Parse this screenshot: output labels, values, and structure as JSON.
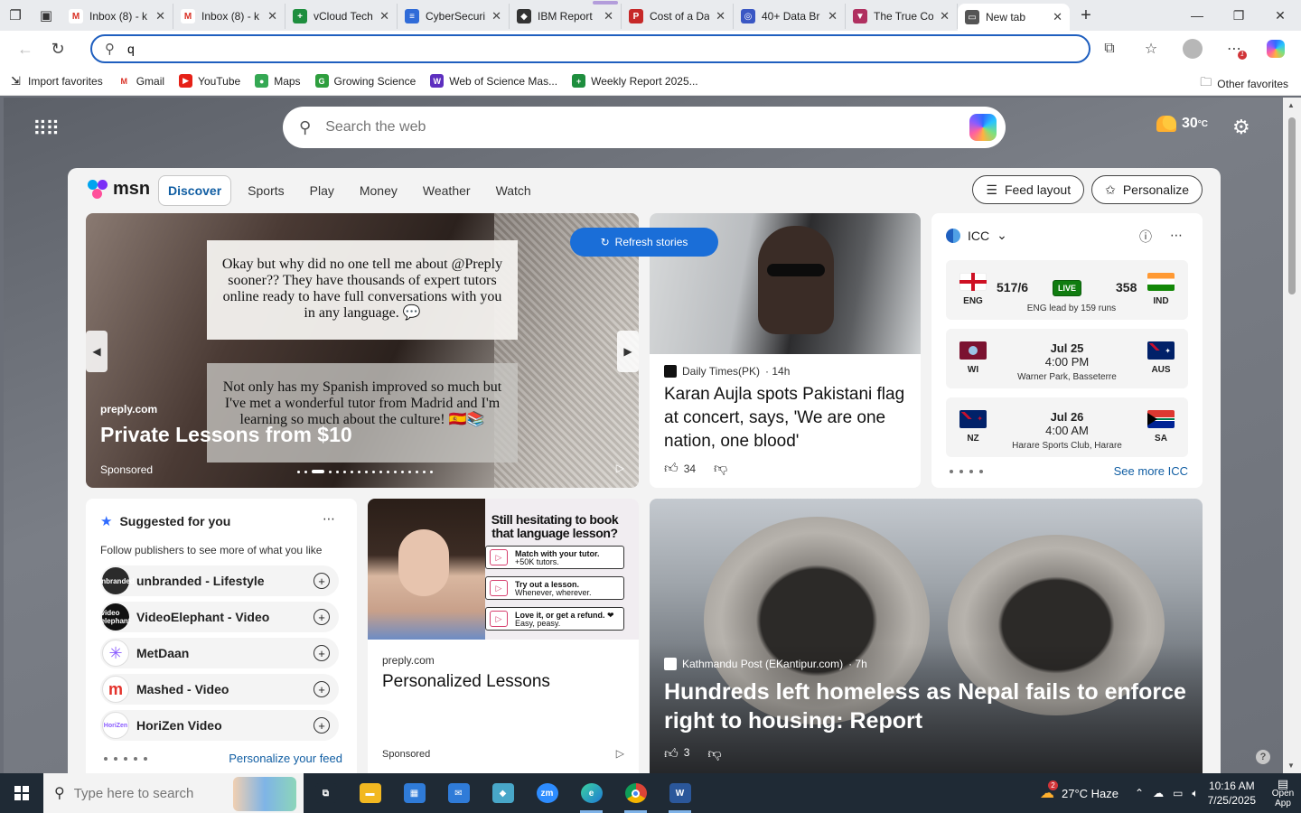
{
  "browser": {
    "tabs": [
      {
        "title": "Inbox (8) - k",
        "icon": "gmail-icon",
        "color": "#ffffff",
        "glyph": "M"
      },
      {
        "title": "Inbox (8) - k",
        "icon": "gmail-icon",
        "color": "#ffffff",
        "glyph": "M"
      },
      {
        "title": "vCloud Tech",
        "icon": "sheets-icon",
        "color": "#1e8e3e",
        "glyph": "+"
      },
      {
        "title": "CyberSecuri",
        "icon": "docs-icon",
        "color": "#2f6bd8",
        "glyph": "≡"
      },
      {
        "title": "IBM Report",
        "icon": "ibm-icon",
        "color": "#333333",
        "glyph": "◆"
      },
      {
        "title": "Cost of a Da",
        "icon": "pdf-icon",
        "color": "#c62828",
        "glyph": "P"
      },
      {
        "title": "40+ Data Br",
        "icon": "shield-icon",
        "color": "#3a57c4",
        "glyph": "◎"
      },
      {
        "title": "The True Co",
        "icon": "shield-icon",
        "color": "#b03060",
        "glyph": "▼"
      },
      {
        "title": "New tab",
        "icon": "newtab-icon",
        "color": "#555555",
        "glyph": "▭"
      }
    ],
    "address": {
      "value": "q"
    },
    "favorites": [
      {
        "label": "Import favorites",
        "icon": "import-icon",
        "color": "#555555",
        "glyph": "⇲"
      },
      {
        "label": "Gmail",
        "icon": "gmail-icon",
        "color": "#ffffff",
        "glyph": "M"
      },
      {
        "label": "YouTube",
        "icon": "youtube-icon",
        "color": "#e62117",
        "glyph": "▶"
      },
      {
        "label": "Maps",
        "icon": "maps-icon",
        "color": "#34a853",
        "glyph": "●"
      },
      {
        "label": "Growing Science",
        "icon": "growing-science-icon",
        "color": "#2e9e3e",
        "glyph": "G"
      },
      {
        "label": "Web of Science Mas...",
        "icon": "web-of-science-icon",
        "color": "#5d2fbf",
        "glyph": "W"
      },
      {
        "label": "Weekly Report 2025...",
        "icon": "sheets-icon",
        "color": "#1e8e3e",
        "glyph": "+"
      }
    ],
    "other_favorites": "Other favorites"
  },
  "newtab": {
    "search_placeholder": "Search the web",
    "temperature": "30",
    "temperature_unit": "°C"
  },
  "msn": {
    "logo_text": "msn",
    "nav": [
      "Discover",
      "Sports",
      "Play",
      "Money",
      "Weather",
      "Watch"
    ],
    "feed_layout": "Feed layout",
    "personalize": "Personalize",
    "refresh": "Refresh stories",
    "hero": {
      "quote1": "Okay but why did no one tell me about @Preply sooner?? They have thousands of expert tutors online ready to have full conversations with you in any language. 💬",
      "quote2": "Not only has my Spanish improved so much but I've met a wonderful tutor from Madrid and I'm learning so much about the culture! 🇪🇸📚",
      "source": "preply.com",
      "title": "Private Lessons from $10",
      "sponsored": "Sponsored"
    },
    "news": {
      "source": "Daily Times(PK)",
      "age": "· 14h",
      "title": "Karan Aujla spots Pakistani flag at concert, says, 'We are one nation, one blood'",
      "likes": "34"
    },
    "icc": {
      "title": "ICC",
      "live": {
        "team1": "ENG",
        "score1": "517/6",
        "team2": "IND",
        "score2": "358",
        "status": "LIVE",
        "note": "ENG lead by 159 runs"
      },
      "upcoming": [
        {
          "team1": "WI",
          "team2": "AUS",
          "date": "Jul 25",
          "time": "4:00 PM",
          "venue": "Warner Park, Basseterre"
        },
        {
          "team1": "NZ",
          "team2": "SA",
          "date": "Jul 26",
          "time": "4:00 AM",
          "venue": "Harare Sports Club, Harare"
        }
      ],
      "see_more": "See more ICC"
    },
    "suggested": {
      "title": "Suggested for you",
      "subtitle": "Follow publishers to see more of what you like",
      "publishers": [
        {
          "name": "unbranded - Lifestyle",
          "logo": "unbranded",
          "color": "#2b2b2b"
        },
        {
          "name": "VideoElephant - Video",
          "logo": "video elephant",
          "color": "#111111"
        },
        {
          "name": "MetDaan",
          "logo": "✳",
          "color": "#ffffff"
        },
        {
          "name": "Mashed - Video",
          "logo": "m",
          "color": "#ffffff"
        },
        {
          "name": "HoriZen Video",
          "logo": "HoriZen",
          "color": "#ffffff"
        }
      ],
      "link": "Personalize your feed"
    },
    "ad": {
      "headline": "Still hesitating to book that language lesson?",
      "features": [
        {
          "title": "Match with your tutor.",
          "sub": "+50K tutors."
        },
        {
          "title": "Try out a lesson.",
          "sub": "Whenever, wherever."
        },
        {
          "title": "Love it, or get a refund. ❤",
          "sub": "Easy, peasy."
        }
      ],
      "source": "preply.com",
      "title": "Personalized Lessons",
      "sponsored": "Sponsored"
    },
    "bignews": {
      "source": "Kathmandu Post (EKantipur.com)",
      "age": "· 7h",
      "title": "Hundreds left homeless as Nepal fails to enforce right to housing: Report",
      "likes": "3"
    }
  },
  "taskbar": {
    "search_placeholder": "Type here to search",
    "apps": [
      {
        "name": "task-view-icon",
        "glyph": "⧉",
        "color": "#1f2a35"
      },
      {
        "name": "file-explorer-icon",
        "glyph": "▬",
        "color": "#f2b821"
      },
      {
        "name": "store-icon",
        "glyph": "▦",
        "color": "#2f7bd8"
      },
      {
        "name": "mail-icon",
        "glyph": "✉",
        "color": "#2f7bd8"
      },
      {
        "name": "app-diamond-icon",
        "glyph": "◆",
        "color": "#48a7c9"
      },
      {
        "name": "zoom-icon",
        "glyph": "zm",
        "color": "#2d8cff"
      },
      {
        "name": "edge-icon",
        "glyph": "e",
        "color": "#1f9ad6"
      },
      {
        "name": "chrome-icon",
        "glyph": "●",
        "color": "#e0443a"
      },
      {
        "name": "word-icon",
        "glyph": "W",
        "color": "#2b579a"
      }
    ],
    "weather": "27°C  Haze",
    "weather_badge": "2",
    "time": "10:16 AM",
    "date": "7/25/2025",
    "notif": "Open App"
  }
}
